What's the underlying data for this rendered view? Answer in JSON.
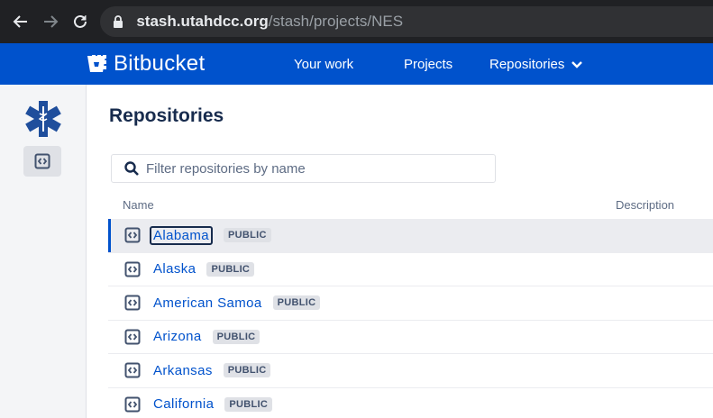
{
  "browser": {
    "url_host": "stash.utahdcc.org",
    "url_path": "/stash/projects/NES"
  },
  "header": {
    "product_name": "Bitbucket",
    "nav": {
      "your_work": "Your work",
      "projects": "Projects",
      "repositories": "Repositories"
    }
  },
  "main": {
    "title": "Repositories",
    "filter_placeholder": "Filter repositories by name",
    "columns": {
      "name": "Name",
      "description": "Description"
    },
    "repos": [
      {
        "name": "Alabama",
        "badge": "PUBLIC",
        "selected": true
      },
      {
        "name": "Alaska",
        "badge": "PUBLIC"
      },
      {
        "name": "American Samoa",
        "badge": "PUBLIC"
      },
      {
        "name": "Arizona",
        "badge": "PUBLIC"
      },
      {
        "name": "Arkansas",
        "badge": "PUBLIC"
      },
      {
        "name": "California",
        "badge": "PUBLIC"
      }
    ]
  },
  "colors": {
    "brand": "#0052cc",
    "browser_bg": "#202124",
    "avatar": "#1f4e9c"
  }
}
